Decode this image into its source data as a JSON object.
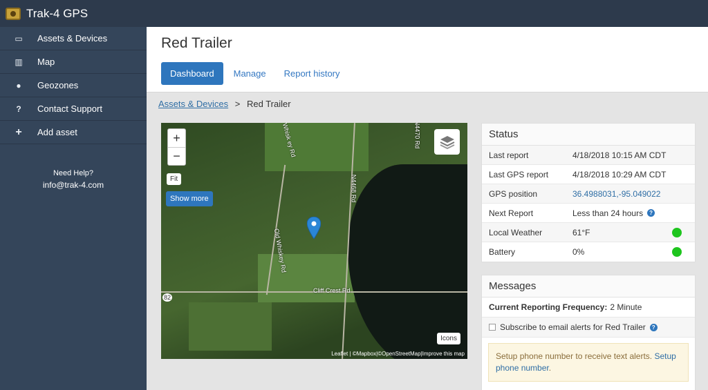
{
  "app": {
    "title": "Trak-4 GPS"
  },
  "sidebar": {
    "items": [
      {
        "label": "Assets & Devices",
        "icon": "inbox-icon"
      },
      {
        "label": "Map",
        "icon": "map-icon"
      },
      {
        "label": "Geozones",
        "icon": "globe-icon"
      },
      {
        "label": "Contact Support",
        "icon": "question-icon"
      },
      {
        "label": "Add asset",
        "icon": "plus-icon"
      }
    ],
    "help": {
      "title": "Need Help?",
      "email": "info@trak-4.com"
    }
  },
  "header": {
    "title": "Red Trailer",
    "tabs": [
      {
        "label": "Dashboard",
        "active": true
      },
      {
        "label": "Manage",
        "active": false
      },
      {
        "label": "Report history",
        "active": false
      }
    ]
  },
  "breadcrumb": {
    "parent": "Assets & Devices",
    "separator": ">",
    "current": "Red Trailer"
  },
  "map": {
    "zoom_in": "+",
    "zoom_out": "−",
    "fit_label": "Fit",
    "show_more_label": "Show more",
    "icons_label": "Icons",
    "attribution": "Leaflet | ©Mapbox|©OpenStreetMap|Improve this map",
    "labels": {
      "road_a": "Whisk ey Rd",
      "road_b": "N4470 Rd",
      "road_c": "N4468 Rd",
      "road_d": "Old Whiskey Rd",
      "road_e": "Cliff Crest Rd",
      "route": "82"
    }
  },
  "status": {
    "title": "Status",
    "rows": [
      {
        "label": "Last report",
        "value": "4/18/2018 10:15 AM CDT"
      },
      {
        "label": "Last GPS report",
        "value": "4/18/2018 10:29 AM CDT"
      },
      {
        "label": "GPS position",
        "value": "36.4988031,-95.049022"
      },
      {
        "label": "Next Report",
        "value": "Less than 24 hours"
      },
      {
        "label": "Local Weather",
        "value": "61°F"
      },
      {
        "label": "Battery",
        "value": "0%"
      }
    ],
    "ok_color": "#1ec51e"
  },
  "messages": {
    "title": "Messages",
    "frequency_label": "Current Reporting Frequency:",
    "frequency_value": "2 Minute",
    "subscribe_label": "Subscribe to email alerts for Red Trailer",
    "alert_text": "Setup phone number to receive text alerts.",
    "alert_link": "Setup phone number",
    "alert_end": "."
  }
}
